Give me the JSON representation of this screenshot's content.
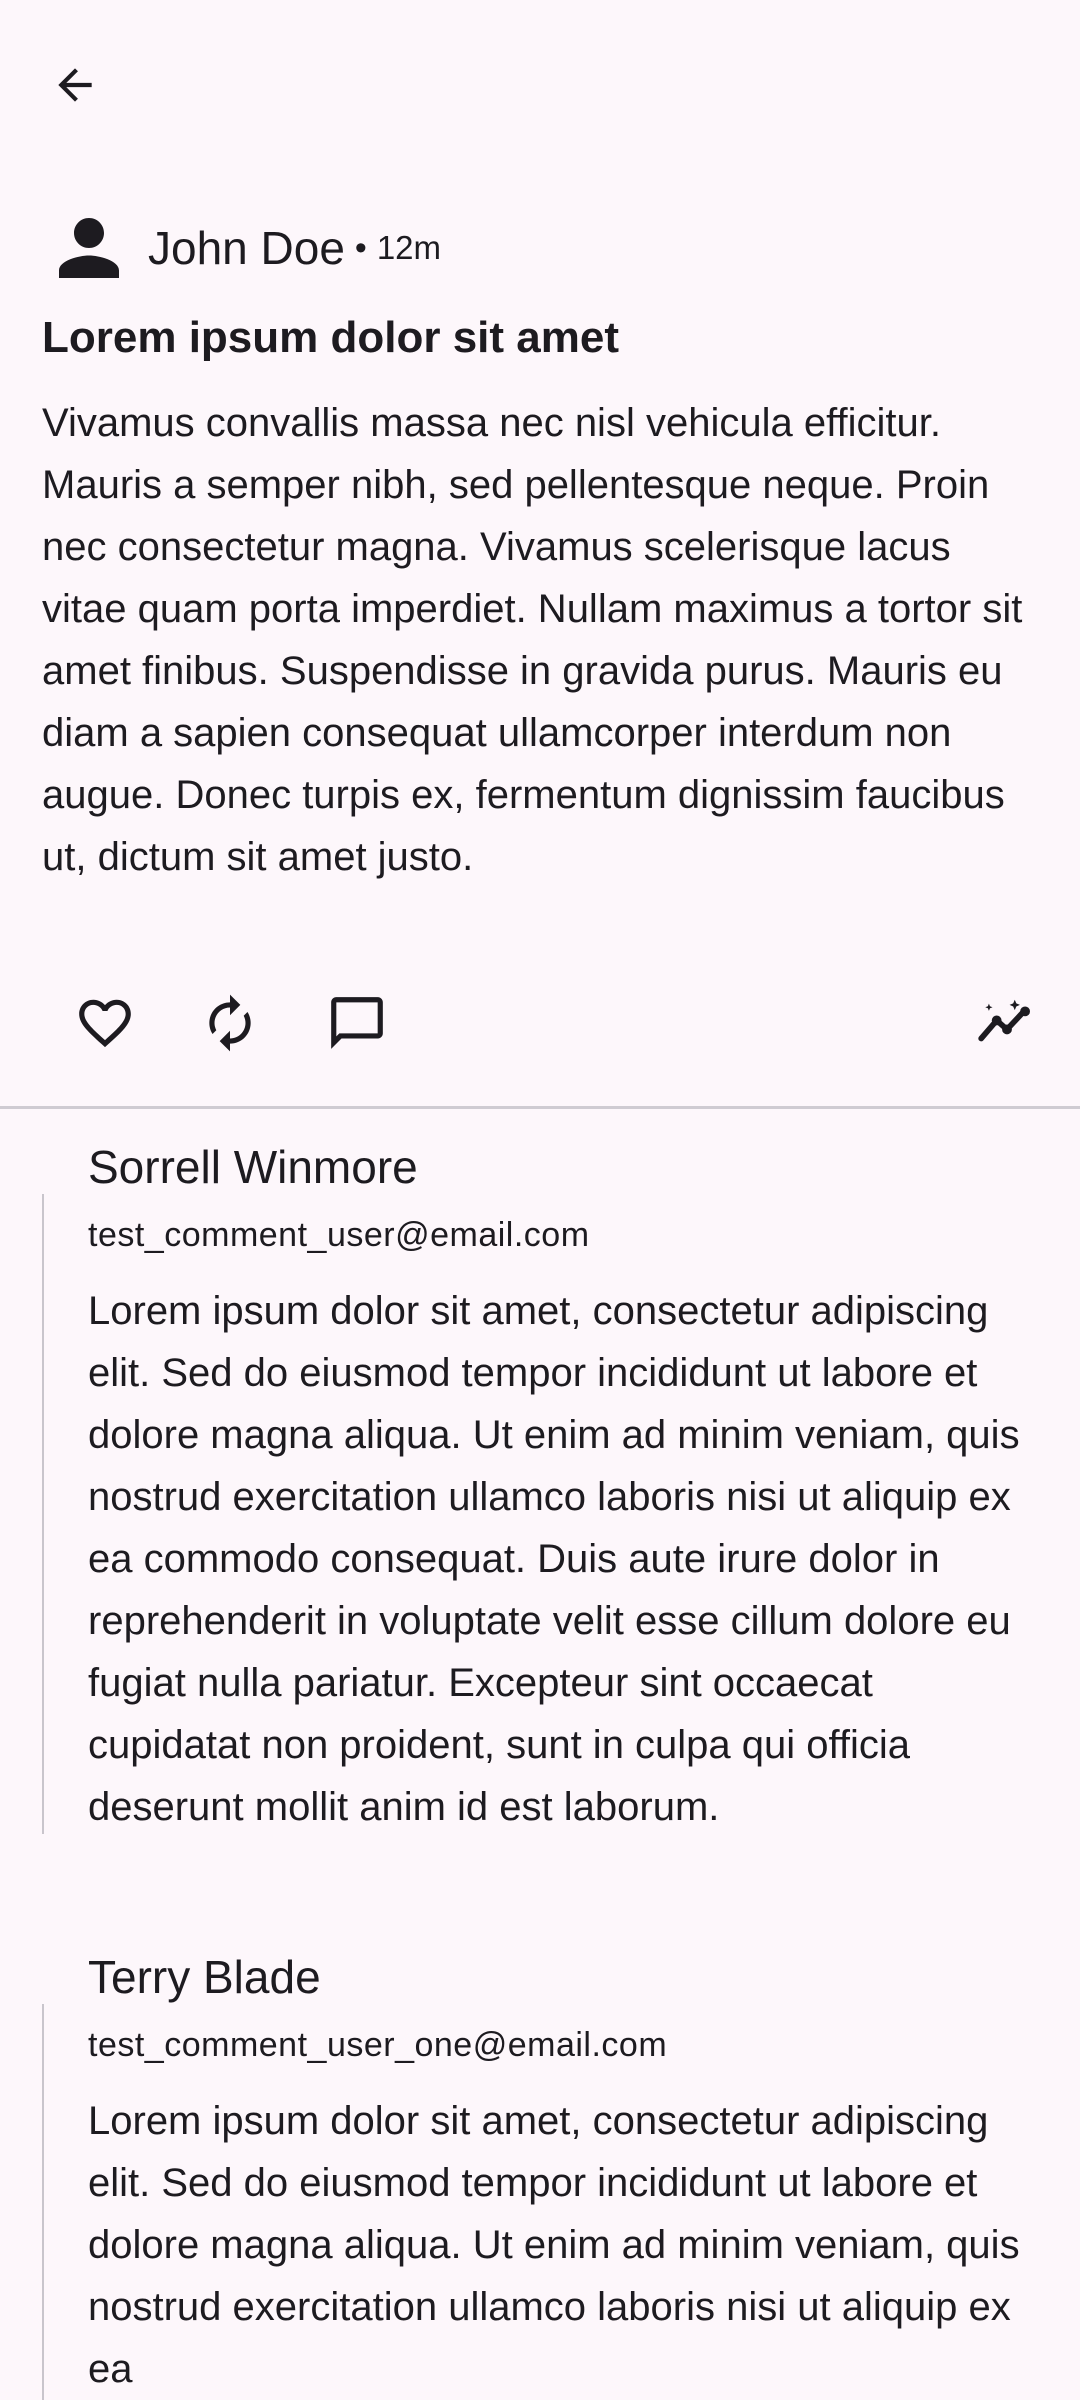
{
  "topbar": {
    "back_icon": "arrow-back-icon"
  },
  "post": {
    "author": "John Doe",
    "separator": "•",
    "time": "12m",
    "title": "Lorem ipsum dolor sit amet",
    "body": "Vivamus convallis massa nec nisl vehicula efficitur. Mauris a semper nibh, sed pellentesque neque. Proin nec consectetur magna. Vivamus scelerisque lacus vitae quam porta imperdiet. Nullam maximus a tortor sit amet finibus. Suspendisse in gravida purus. Mauris eu diam a sapien consequat ullamcorper interdum non augue. Donec turpis ex, fermentum dignissim faucibus ut, dictum sit amet justo.",
    "actions": [
      "heart-outline-icon",
      "repost-icon",
      "comment-outline-icon",
      "insights-icon"
    ]
  },
  "comments": [
    {
      "name": "Sorrell Winmore",
      "email": "test_comment_user@email.com",
      "body": "Lorem ipsum dolor sit amet, consectetur adipiscing elit. Sed do eiusmod tempor incididunt ut labore et dolore magna aliqua. Ut enim ad minim veniam, quis nostrud exercitation ullamco laboris nisi ut aliquip ex ea commodo consequat. Duis aute irure dolor in reprehenderit in voluptate velit esse cillum dolore eu fugiat nulla pariatur. Excepteur sint occaecat cupidatat non proident, sunt in culpa qui officia deserunt mollit anim id est laborum."
    },
    {
      "name": "Terry Blade",
      "email": "test_comment_user_one@email.com",
      "body": "Lorem ipsum dolor sit amet, consectetur adipiscing elit. Sed do eiusmod tempor incididunt ut labore et dolore magna aliqua. Ut enim ad minim veniam, quis nostrud exercitation ullamco laboris nisi ut aliquip ex ea"
    }
  ],
  "colors": {
    "background": "#fdf7fb",
    "text": "#1d1b20",
    "divider": "#cfcbd2"
  }
}
